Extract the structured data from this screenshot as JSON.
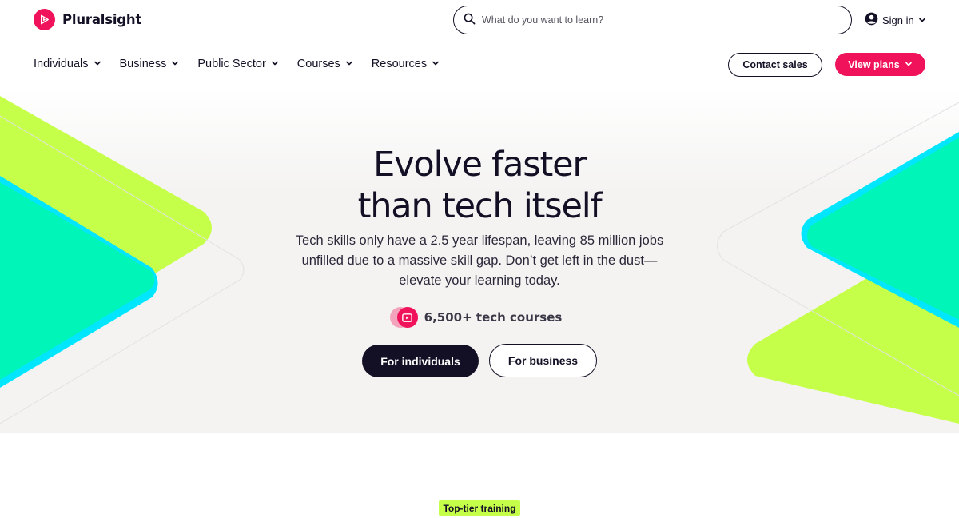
{
  "brand": {
    "name": "Pluralsight",
    "accent": "#f0125a",
    "dark": "#130f25",
    "lime": "#c6ff4a",
    "cyan": "#00e6ff",
    "teal": "#00f5b8"
  },
  "search": {
    "placeholder": "What do you want to learn?"
  },
  "account": {
    "signin_label": "Sign in"
  },
  "nav": {
    "items": [
      {
        "label": "Individuals"
      },
      {
        "label": "Business"
      },
      {
        "label": "Public Sector"
      },
      {
        "label": "Courses"
      },
      {
        "label": "Resources"
      }
    ],
    "contact_label": "Contact sales",
    "plans_label": "View plans"
  },
  "hero": {
    "title_line1": "Evolve faster",
    "title_line2": "than tech itself",
    "subtitle": "Tech skills only have a 2.5 year lifespan, leaving 85 million jobs unfilled due to a massive skill gap. Don’t get left in the dust—elevate your learning today.",
    "stat": "6,500+ tech courses",
    "cta_individuals": "For individuals",
    "cta_business": "For business"
  },
  "section": {
    "tag": "Top-tier training"
  },
  "icons": [
    "play-logo-icon",
    "search-icon",
    "user-icon",
    "chevron-down-icon",
    "video-course-icon"
  ]
}
